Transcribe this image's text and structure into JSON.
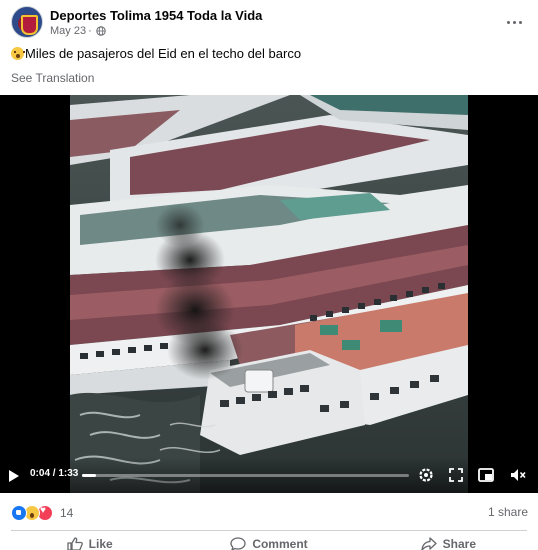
{
  "post": {
    "page_name": "Deportes Tolima 1954 Toda la Vida",
    "date": "May 23",
    "separator": "·",
    "caption": "Miles de pasajeros del Eid en el techo del barco",
    "caption_emoji": "astonished-face-emoji",
    "see_translation": "See Translation"
  },
  "video": {
    "time": "0:04 / 1:33",
    "progress_fraction": 0.043,
    "controls": [
      "play-icon",
      "settings-gear-icon",
      "fullscreen-icon",
      "mini-player-icon",
      "volume-muted-icon"
    ]
  },
  "engagement": {
    "reaction_icons": [
      "like",
      "wow",
      "love"
    ],
    "reaction_count": "14",
    "shares": "1 share"
  },
  "actions": {
    "like": "Like",
    "comment": "Comment",
    "share": "Share"
  },
  "colors": {
    "brand_blue": "#1877f2",
    "secondary_text": "#65676b",
    "primary_text": "#050505",
    "video_bg": "#000000"
  }
}
